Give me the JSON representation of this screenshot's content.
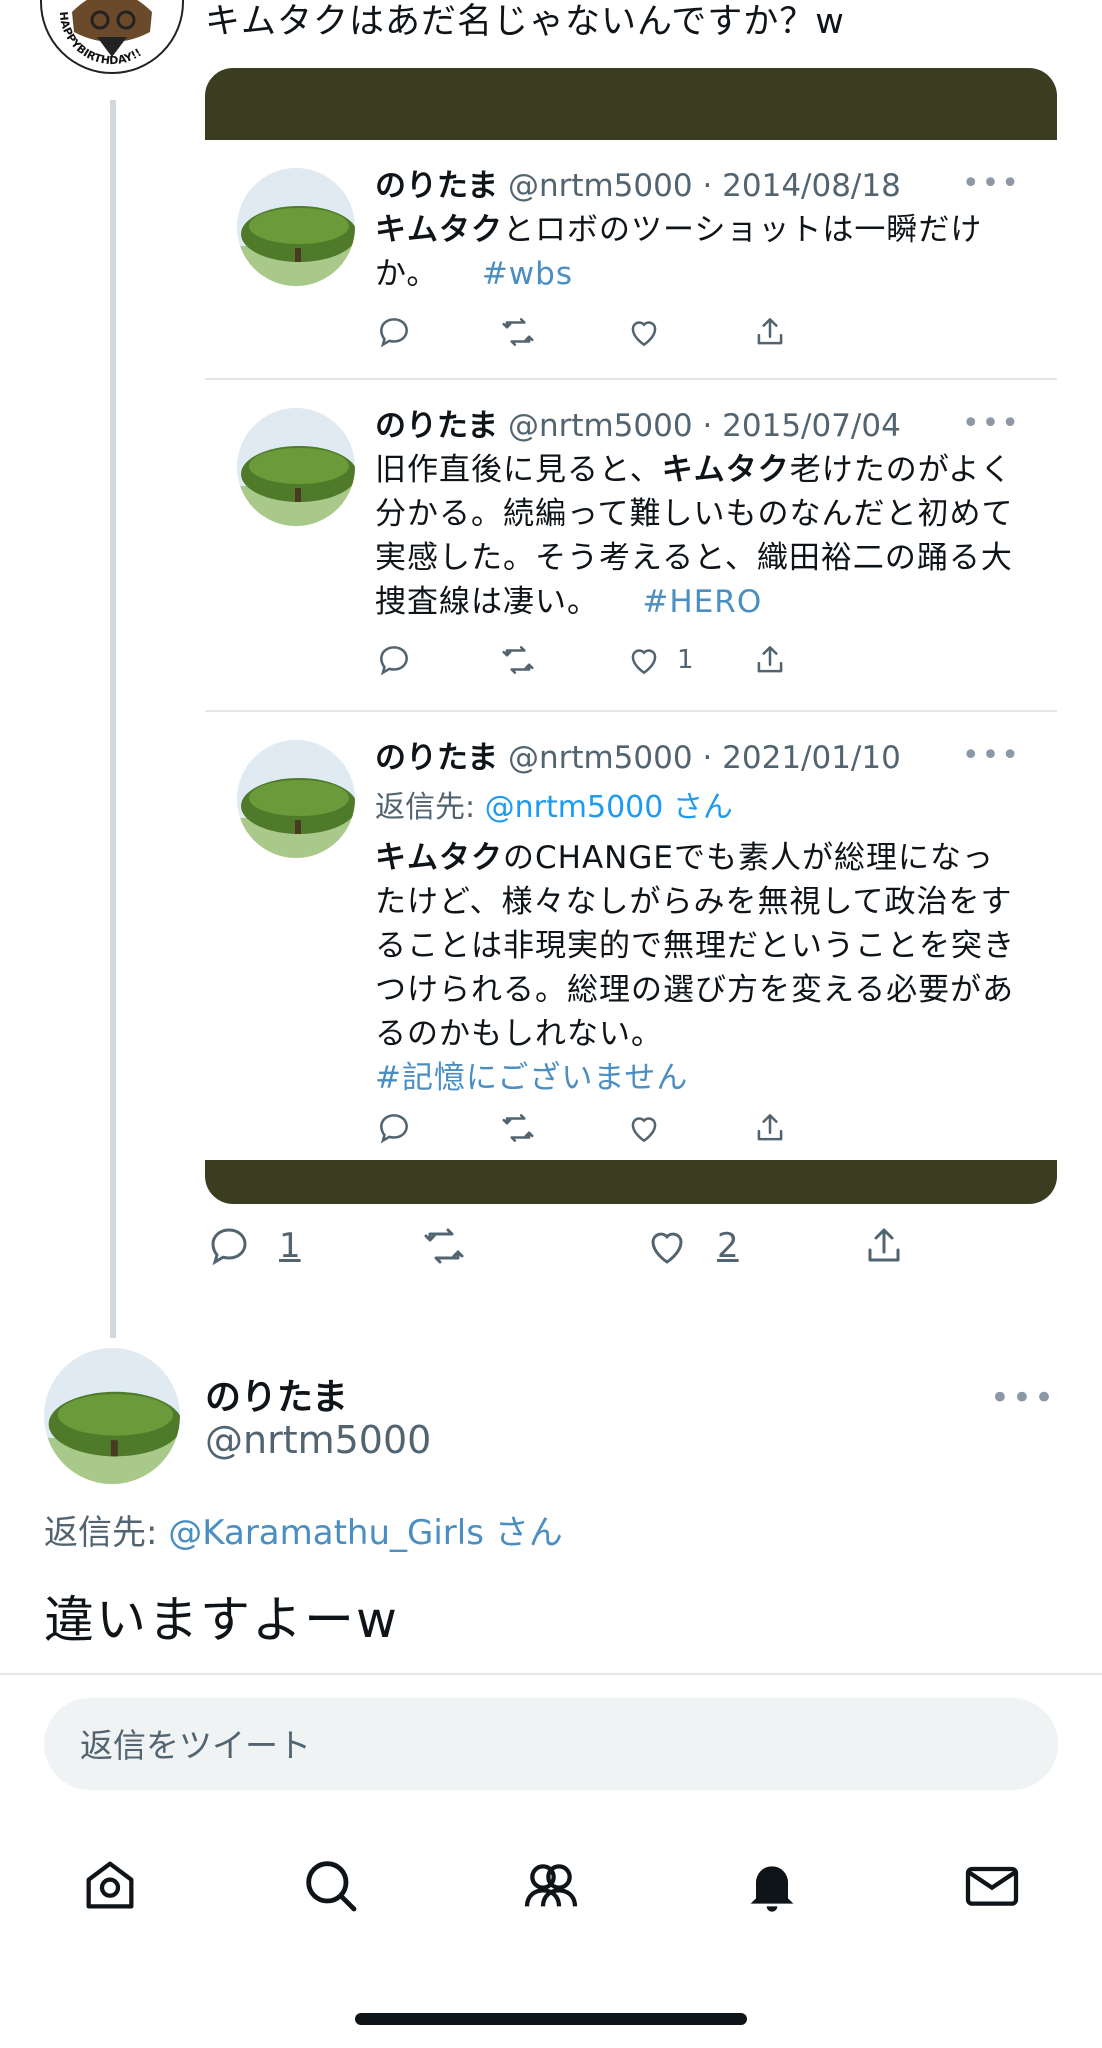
{
  "quoted_context": {
    "text": "キムタクはあだ名じゃないんですか？w",
    "avatar_badge_text": "HAPPYBIRTHDAY!!"
  },
  "embedded_tweets": [
    {
      "name": "のりたま",
      "handle": "@nrtm5000",
      "date": "· 2014/08/18",
      "body_bold": "キムタク",
      "body_line1_rest": "とロボのツーショットは一瞬だけ",
      "body_line2": "か。",
      "hashtag": "#wbs",
      "likes": ""
    },
    {
      "name": "のりたま",
      "handle": "@nrtm5000",
      "date": "· 2015/07/04",
      "body_line1_pre": "旧作直後に見ると、",
      "body_bold": "キムタク",
      "body_line1_rest": "老けたのがよく",
      "body_line2": "分かる。続編って難しいものなんだと初めて",
      "body_line3": "実感した。そう考えると、織田裕二の踊る大",
      "body_line4": "捜査線は凄い。",
      "hashtag": "#HERO",
      "likes": "1"
    },
    {
      "name": "のりたま",
      "handle": "@nrtm5000",
      "date": "· 2021/01/10",
      "replyto_label": "返信先:",
      "replyto_mention": "@nrtm5000 さん",
      "body_bold": "キムタク",
      "body_line1_rest": "のCHANGEでも素人が総理になっ",
      "body_line2": "たけど、様々なしがらみを無視して政治をす",
      "body_line3": "ることは非現実的で無理だということを突き",
      "body_line4": "つけられる。総理の選び方を変える必要があ",
      "body_line5": "るのかもしれない。",
      "hashtag": "#記憶にございません",
      "likes": ""
    }
  ],
  "main_actions": {
    "replies": "1",
    "likes": "2"
  },
  "reply": {
    "name": "のりたま",
    "handle": "@nrtm5000",
    "replyto_label": "返信先:",
    "replyto_mention": "@Karamathu_Girls さん",
    "text": "違いますよーw",
    "more": "•••"
  },
  "compose": {
    "placeholder": "返信をツイート"
  },
  "tabbar": {
    "items": [
      "home-icon",
      "search-icon",
      "communities-icon",
      "notifications-icon",
      "messages-icon"
    ]
  },
  "colors": {
    "embed_frame": "#3b3d20",
    "link": "#1d9bf0",
    "hashtag": "#4a8ec2",
    "muted": "#536471"
  }
}
